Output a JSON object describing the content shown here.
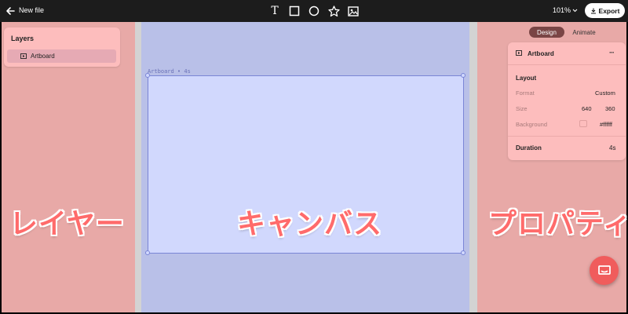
{
  "topbar": {
    "back_icon": "arrow-left-icon",
    "file_name": "New file",
    "tools": [
      {
        "name": "text-tool",
        "icon": "text-icon",
        "glyph": "T"
      },
      {
        "name": "rectangle-tool",
        "icon": "rectangle-icon"
      },
      {
        "name": "ellipse-tool",
        "icon": "circle-icon"
      },
      {
        "name": "star-tool",
        "icon": "star-icon"
      },
      {
        "name": "image-tool",
        "icon": "image-icon"
      }
    ],
    "zoom": "101%",
    "export_label": "Export",
    "export_icon": "download-icon"
  },
  "layers": {
    "title": "Layers",
    "items": [
      {
        "label": "Artboard",
        "icon": "artboard-icon"
      }
    ]
  },
  "canvas": {
    "artboard_label": "Artboard • 4s"
  },
  "overlay_labels": {
    "layers": "レイヤー",
    "canvas": "キャンバス",
    "properties": "プロパティ"
  },
  "properties": {
    "tabs": [
      {
        "label": "Design",
        "active": true
      },
      {
        "label": "Animate",
        "active": false
      }
    ],
    "header_title": "Artboard",
    "more_label": "···",
    "section_title": "Layout",
    "format_label": "Format",
    "format_value": "Custom",
    "size_label": "Size",
    "size_width": "640",
    "size_height": "360",
    "background_label": "Background",
    "background_value": "#ffffff",
    "duration_label": "Duration",
    "duration_value": "4s"
  },
  "colors": {
    "topbar": "#1c1c1c",
    "panel_region": "#e8a9a7",
    "canvas_region": "#b9c0e8",
    "panel_card": "#fdbdbd",
    "artboard": "#d1d8fd",
    "active_tab": "#7a4545",
    "chat_fab": "#f05c5c",
    "overlay_text": "#ff6b6b"
  }
}
